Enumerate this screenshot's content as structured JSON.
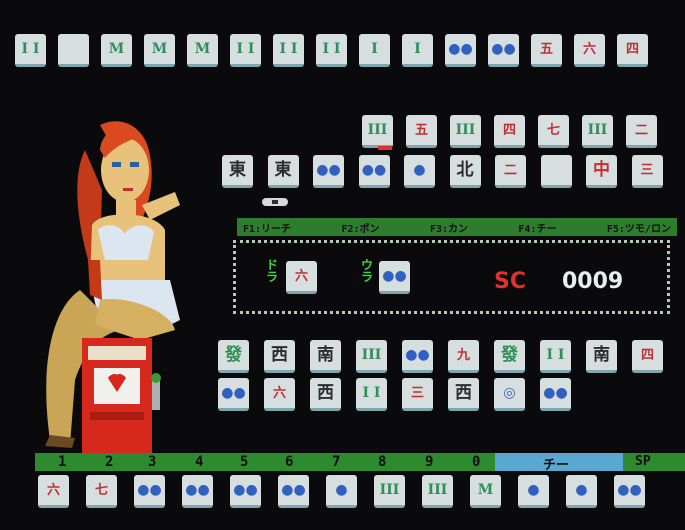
{
  "function_keys": [
    "F1:リーチ",
    "F2:ポン",
    "F3:カン",
    "F4:チー",
    "F5:ツモ/ロン"
  ],
  "dora_label": "ドラ",
  "ura_label": "ウラ",
  "score_label": "SC",
  "score_value": "0009",
  "slot_numbers": [
    "1",
    "2",
    "3",
    "4",
    "5",
    "6",
    "7",
    "8",
    "9",
    "0"
  ],
  "chi_label": "チー",
  "sp_label": "SP",
  "colors": {
    "bar_green": "#2e8a2e",
    "chi_blue": "#5aa7d2",
    "score_red": "#e03030"
  },
  "rows": {
    "top": [
      {
        "text": "I I",
        "kind": "s"
      },
      {
        "text": "",
        "kind": "e"
      },
      {
        "text": "M",
        "kind": "s"
      },
      {
        "text": "M",
        "kind": "s"
      },
      {
        "text": "M",
        "kind": "s"
      },
      {
        "text": "I I",
        "kind": "s"
      },
      {
        "text": "I I",
        "kind": "s"
      },
      {
        "text": "I I",
        "kind": "s"
      },
      {
        "text": "I",
        "kind": "s"
      },
      {
        "text": "I",
        "kind": "s"
      },
      {
        "text": "●●",
        "kind": "p"
      },
      {
        "text": "●●",
        "kind": "p"
      },
      {
        "text": "五",
        "kind": "m"
      },
      {
        "text": "六",
        "kind": "m"
      },
      {
        "text": "四",
        "kind": "m"
      }
    ],
    "opp_discard_1": [
      {
        "text": "III",
        "kind": "s"
      },
      {
        "text": "五",
        "kind": "m"
      },
      {
        "text": "III",
        "kind": "s"
      },
      {
        "text": "四",
        "kind": "m"
      },
      {
        "text": "七",
        "kind": "m"
      },
      {
        "text": "III",
        "kind": "s"
      },
      {
        "text": "二",
        "kind": "m"
      }
    ],
    "opp_discard_2": [
      {
        "text": "東",
        "kind": "w"
      },
      {
        "text": "東",
        "kind": "w"
      },
      {
        "text": "●●",
        "kind": "p"
      },
      {
        "text": "●●",
        "kind": "p"
      },
      {
        "text": "●",
        "kind": "p"
      },
      {
        "text": "北",
        "kind": "w"
      },
      {
        "text": "二",
        "kind": "m"
      },
      {
        "text": "",
        "kind": "e"
      },
      {
        "text": "中",
        "kind": "r"
      },
      {
        "text": "三",
        "kind": "m"
      }
    ],
    "dora_tile": {
      "text": "六",
      "kind": "m"
    },
    "ura_tile": {
      "text": "●●",
      "kind": "p"
    },
    "player_discard_1": [
      {
        "text": "發",
        "kind": "g"
      },
      {
        "text": "西",
        "kind": "w"
      },
      {
        "text": "南",
        "kind": "w"
      },
      {
        "text": "III",
        "kind": "s"
      },
      {
        "text": "●●",
        "kind": "p"
      },
      {
        "text": "九",
        "kind": "m"
      },
      {
        "text": "發",
        "kind": "g"
      },
      {
        "text": "I I",
        "kind": "s"
      },
      {
        "text": "南",
        "kind": "w"
      },
      {
        "text": "四",
        "kind": "m"
      }
    ],
    "player_discard_2": [
      {
        "text": "●●",
        "kind": "p"
      },
      {
        "text": "六",
        "kind": "m"
      },
      {
        "text": "西",
        "kind": "w"
      },
      {
        "text": "I I",
        "kind": "s"
      },
      {
        "text": "三",
        "kind": "m"
      },
      {
        "text": "西",
        "kind": "w"
      },
      {
        "text": "◎",
        "kind": "p"
      },
      {
        "text": "●●",
        "kind": "p"
      }
    ],
    "hand": [
      {
        "text": "六",
        "kind": "m"
      },
      {
        "text": "七",
        "kind": "m"
      },
      {
        "text": "●●",
        "kind": "p"
      },
      {
        "text": "●●",
        "kind": "p"
      },
      {
        "text": "●●",
        "kind": "p"
      },
      {
        "text": "●●",
        "kind": "p"
      },
      {
        "text": "●",
        "kind": "p"
      },
      {
        "text": "III",
        "kind": "s"
      },
      {
        "text": "III",
        "kind": "s"
      },
      {
        "text": "M",
        "kind": "s"
      },
      {
        "text": "●",
        "kind": "p"
      },
      {
        "text": "●",
        "kind": "p"
      },
      {
        "text": "●●",
        "kind": "p"
      }
    ]
  }
}
